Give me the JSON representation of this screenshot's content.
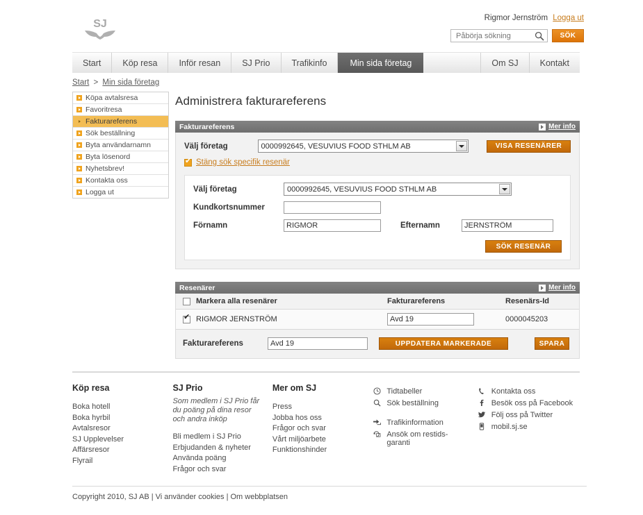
{
  "header": {
    "logo_text": "SJ",
    "user_name": "Rigmor Jernström",
    "logout_label": "Logga ut",
    "search_placeholder": "Påbörja sökning",
    "search_value": "",
    "search_button": "SÖK",
    "search_icon": "search-icon"
  },
  "nav": {
    "left_items": [
      {
        "label": "Start",
        "active": false
      },
      {
        "label": "Köp resa",
        "active": false
      },
      {
        "label": "Inför resan",
        "active": false
      },
      {
        "label": "SJ Prio",
        "active": false
      },
      {
        "label": "Trafikinfo",
        "active": false
      },
      {
        "label": "Min sida företag",
        "active": true
      }
    ],
    "right_items": [
      {
        "label": "Om SJ"
      },
      {
        "label": "Kontakt"
      }
    ]
  },
  "breadcrumb": {
    "items": [
      "Start",
      "Min sida företag"
    ],
    "separator": ">"
  },
  "sidebar": {
    "items": [
      {
        "label": "Köpa avtalsresa",
        "active": false
      },
      {
        "label": "Favoritresa",
        "active": false
      },
      {
        "label": "Fakturareferens",
        "active": true
      },
      {
        "label": "Sök beställning",
        "active": false
      },
      {
        "label": "Byta användarnamn",
        "active": false
      },
      {
        "label": "Byta lösenord",
        "active": false
      },
      {
        "label": "Nyhetsbrev!",
        "active": false
      },
      {
        "label": "Kontakta oss",
        "active": false
      },
      {
        "label": "Logga ut",
        "active": false
      }
    ]
  },
  "main": {
    "page_title": "Administrera fakturareferens",
    "panel1": {
      "title": "Fakturareferens",
      "more_info": "Mer info",
      "company_label": "Välj företag",
      "company_value": "0000992645, VESUVIUS FOOD STHLM AB",
      "show_travellers_button": "VISA RESENÄRER",
      "toggle_label": "Stäng sök specifik resenär",
      "search_company_label": "Välj företag",
      "search_company_value": "0000992645, VESUVIUS FOOD STHLM AB",
      "customer_card_label": "Kundkortsnummer",
      "customer_card_value": "",
      "firstname_label": "Förnamn",
      "firstname_value": "RIGMOR",
      "lastname_label": "Efternamn",
      "lastname_value": "JERNSTRÖM",
      "search_traveller_button": "SÖK RESENÄR"
    },
    "panel2": {
      "title": "Resenärer",
      "more_info": "Mer info",
      "columns": [
        "Markera alla resenärer",
        "Fakturareferens",
        "Resenärs-Id"
      ],
      "rows": [
        {
          "checked": true,
          "name": "RIGMOR JERNSTRÖM",
          "invoice_ref": "Avd 19",
          "traveller_id": "0000045203"
        }
      ],
      "bulk_label": "Fakturareferens",
      "bulk_value": "Avd 19",
      "update_button": "UPPDATERA MARKERADE",
      "save_button": "SPARA"
    }
  },
  "footer": {
    "columns": [
      {
        "title": "Köp resa",
        "intro": "",
        "links": [
          "Boka hotell",
          "Boka hyrbil",
          "Avtalsresor",
          "SJ Upplevelser",
          "Affärsresor",
          "Flyrail"
        ]
      },
      {
        "title": "SJ Prio",
        "intro": "Som medlem i SJ Prio får du poäng på dina resor och andra inköp",
        "links": [
          "Bli medlem i SJ Prio",
          "Erbjudanden & nyheter",
          "Använda poäng",
          "Frågor och svar"
        ]
      },
      {
        "title": "Mer om SJ",
        "intro": "",
        "links": [
          "Press",
          "Jobba hos oss",
          "Frågor och svar",
          "Vårt miljöarbete",
          "Funktionshinder"
        ]
      }
    ],
    "icon_column_1": [
      {
        "icon": "clock-icon",
        "label": "Tidtabeller"
      },
      {
        "icon": "search-icon",
        "label": "Sök beställning"
      },
      {
        "icon": "traffic-info-icon",
        "label": "Trafikinformation"
      },
      {
        "icon": "refund-icon",
        "label": "Ansök om restids-\ngaranti"
      }
    ],
    "icon_column_2": [
      {
        "icon": "phone-icon",
        "label": "Kontakta oss"
      },
      {
        "icon": "facebook-icon",
        "label": "Besök oss på Facebook"
      },
      {
        "icon": "twitter-icon",
        "label": "Följ oss på Twitter"
      },
      {
        "icon": "mobile-icon",
        "label": "mobil.sj.se"
      }
    ],
    "copyright": "Copyright 2010, SJ AB | Vi använder cookies | Om webbplatsen"
  },
  "colors": {
    "accent_orange": "#e07b12",
    "button_orange": "#c2690a",
    "sidebar_active": "#f3bd54",
    "panel_header_gray": "#6f6f6f",
    "nav_active_gray": "#585858"
  }
}
